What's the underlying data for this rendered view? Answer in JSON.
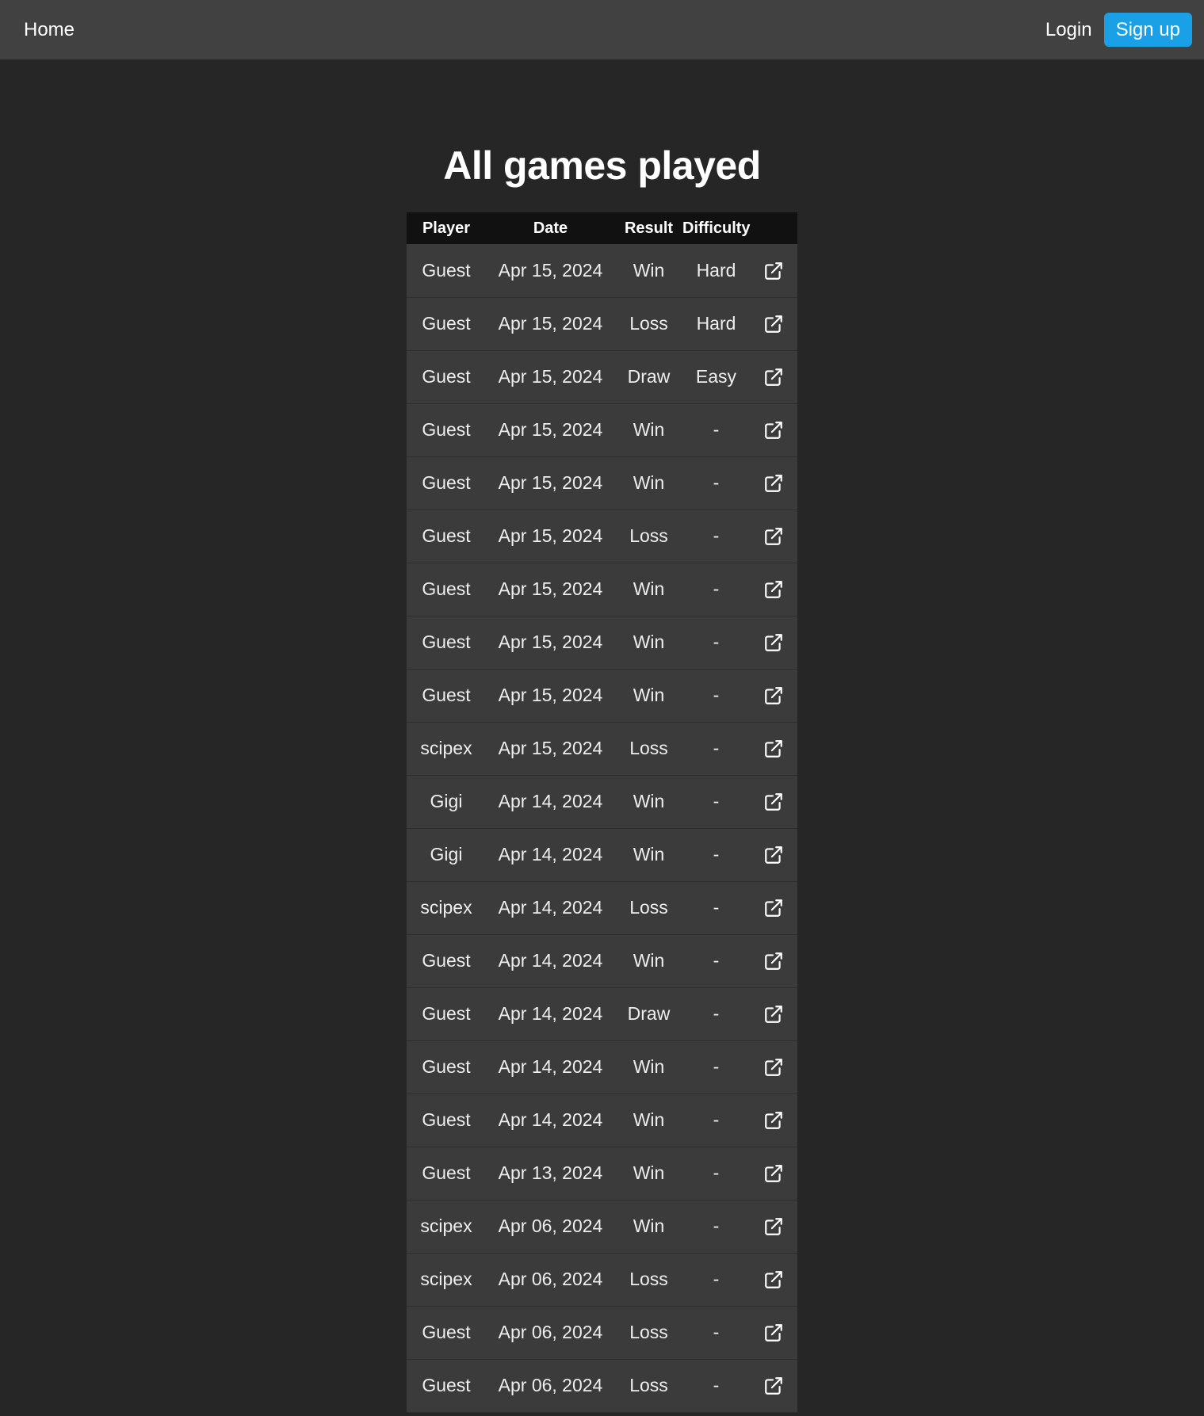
{
  "nav": {
    "home": "Home",
    "login": "Login",
    "signup": "Sign up"
  },
  "title": "All games played",
  "table": {
    "headers": [
      "Player",
      "Date",
      "Result",
      "Difficulty",
      ""
    ],
    "rows": [
      {
        "player": "Guest",
        "date": "Apr 15, 2024",
        "result": "Win",
        "difficulty": "Hard"
      },
      {
        "player": "Guest",
        "date": "Apr 15, 2024",
        "result": "Loss",
        "difficulty": "Hard"
      },
      {
        "player": "Guest",
        "date": "Apr 15, 2024",
        "result": "Draw",
        "difficulty": "Easy"
      },
      {
        "player": "Guest",
        "date": "Apr 15, 2024",
        "result": "Win",
        "difficulty": "-"
      },
      {
        "player": "Guest",
        "date": "Apr 15, 2024",
        "result": "Win",
        "difficulty": "-"
      },
      {
        "player": "Guest",
        "date": "Apr 15, 2024",
        "result": "Loss",
        "difficulty": "-"
      },
      {
        "player": "Guest",
        "date": "Apr 15, 2024",
        "result": "Win",
        "difficulty": "-"
      },
      {
        "player": "Guest",
        "date": "Apr 15, 2024",
        "result": "Win",
        "difficulty": "-"
      },
      {
        "player": "Guest",
        "date": "Apr 15, 2024",
        "result": "Win",
        "difficulty": "-"
      },
      {
        "player": "scipex",
        "date": "Apr 15, 2024",
        "result": "Loss",
        "difficulty": "-"
      },
      {
        "player": "Gigi",
        "date": "Apr 14, 2024",
        "result": "Win",
        "difficulty": "-"
      },
      {
        "player": "Gigi",
        "date": "Apr 14, 2024",
        "result": "Win",
        "difficulty": "-"
      },
      {
        "player": "scipex",
        "date": "Apr 14, 2024",
        "result": "Loss",
        "difficulty": "-"
      },
      {
        "player": "Guest",
        "date": "Apr 14, 2024",
        "result": "Win",
        "difficulty": "-"
      },
      {
        "player": "Guest",
        "date": "Apr 14, 2024",
        "result": "Draw",
        "difficulty": "-"
      },
      {
        "player": "Guest",
        "date": "Apr 14, 2024",
        "result": "Win",
        "difficulty": "-"
      },
      {
        "player": "Guest",
        "date": "Apr 14, 2024",
        "result": "Win",
        "difficulty": "-"
      },
      {
        "player": "Guest",
        "date": "Apr 13, 2024",
        "result": "Win",
        "difficulty": "-"
      },
      {
        "player": "scipex",
        "date": "Apr 06, 2024",
        "result": "Win",
        "difficulty": "-"
      },
      {
        "player": "scipex",
        "date": "Apr 06, 2024",
        "result": "Loss",
        "difficulty": "-"
      },
      {
        "player": "Guest",
        "date": "Apr 06, 2024",
        "result": "Loss",
        "difficulty": "-"
      },
      {
        "player": "Guest",
        "date": "Apr 06, 2024",
        "result": "Loss",
        "difficulty": "-"
      }
    ]
  },
  "icons": {
    "row_link": "external-link-icon"
  },
  "colors": {
    "page_bg": "#262626",
    "navbar_bg": "#414141",
    "signup_bg": "#1aa0e6",
    "table_header_bg": "#111111",
    "row_bg": "#3b3b3b"
  }
}
